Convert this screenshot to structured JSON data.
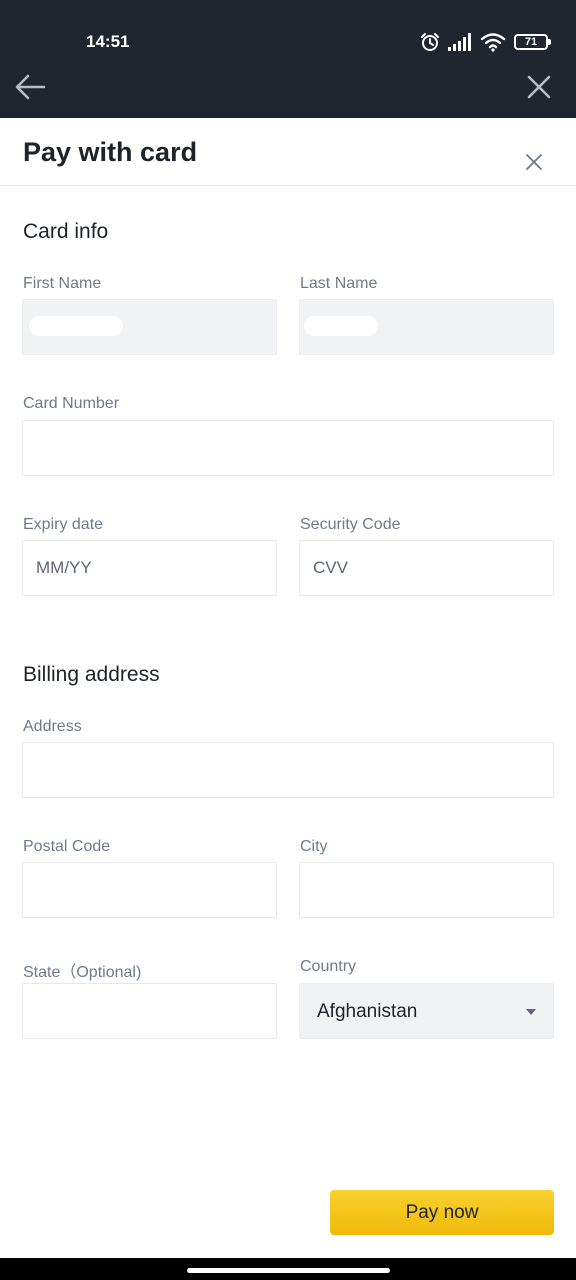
{
  "status_bar": {
    "time": "14:51",
    "battery": "71",
    "icons": [
      "alarm-icon",
      "signal-icon",
      "wifi-icon",
      "battery-icon"
    ]
  },
  "nav": {
    "back_icon": "arrow-left-icon",
    "close_icon": "close-icon"
  },
  "sheet": {
    "title": "Pay with card",
    "close_icon": "close-icon"
  },
  "card_info": {
    "heading": "Card info",
    "first_name_label": "First Name",
    "last_name_label": "Last Name",
    "card_number_label": "Card Number",
    "expiry_label": "Expiry date",
    "expiry_placeholder": "MM/YY",
    "security_label": "Security Code",
    "security_placeholder": "CVV"
  },
  "billing": {
    "heading": "Billing address",
    "address_label": "Address",
    "postal_label": "Postal Code",
    "city_label": "City",
    "state_label": "State（Optional)",
    "country_label": "Country",
    "country_value": "Afghanistan"
  },
  "actions": {
    "pay_label": "Pay now"
  },
  "colors": {
    "status_bar_bg": "#1f2630",
    "accent": "#f0b90b",
    "text_primary": "#1e2329",
    "text_secondary": "#707a8a"
  }
}
